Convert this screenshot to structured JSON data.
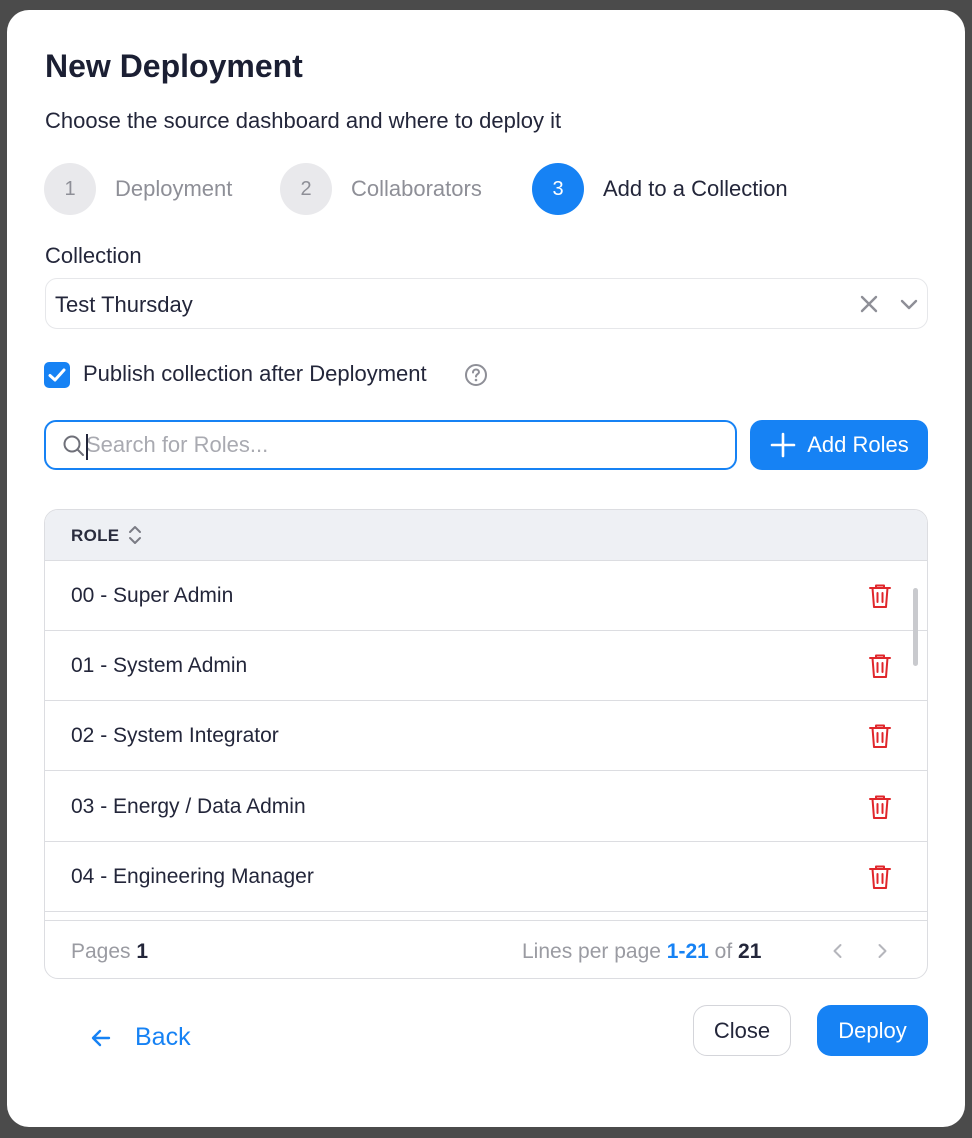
{
  "dialog": {
    "title": "New Deployment",
    "subtitle": "Choose the source dashboard and where to deploy it"
  },
  "steps": [
    {
      "number": "1",
      "label": "Deployment",
      "active": false
    },
    {
      "number": "2",
      "label": "Collaborators",
      "active": false
    },
    {
      "number": "3",
      "label": "Add to a Collection",
      "active": true
    }
  ],
  "collection": {
    "label": "Collection",
    "value": "Test Thursday",
    "clear_icon": "close-icon",
    "dropdown_icon": "chevron-down-icon"
  },
  "publish": {
    "checked": true,
    "label": "Publish collection after Deployment",
    "help_icon": "help-circle-icon"
  },
  "search": {
    "placeholder": "Search for Roles...",
    "value": ""
  },
  "add_roles": {
    "label": "Add Roles",
    "icon": "plus-icon"
  },
  "table": {
    "header": "ROLE",
    "sort_icon": "sort-icon",
    "rows": [
      {
        "name": "00 - Super Admin"
      },
      {
        "name": "01 - System Admin"
      },
      {
        "name": "02 - System Integrator"
      },
      {
        "name": "03 - Energy / Data Admin"
      },
      {
        "name": "04 - Engineering Manager"
      }
    ],
    "row_action_icon": "trash-icon"
  },
  "pagination": {
    "pages_label": "Pages",
    "pages_value": "1",
    "lines_label": "Lines per page",
    "range": "1-21",
    "of_label": "of",
    "total": "21"
  },
  "footer": {
    "back_label": "Back",
    "close_label": "Close",
    "deploy_label": "Deploy"
  },
  "colors": {
    "accent": "#1682f4",
    "danger": "#e0262b",
    "text": "#23263a",
    "muted": "#8e8f97"
  }
}
